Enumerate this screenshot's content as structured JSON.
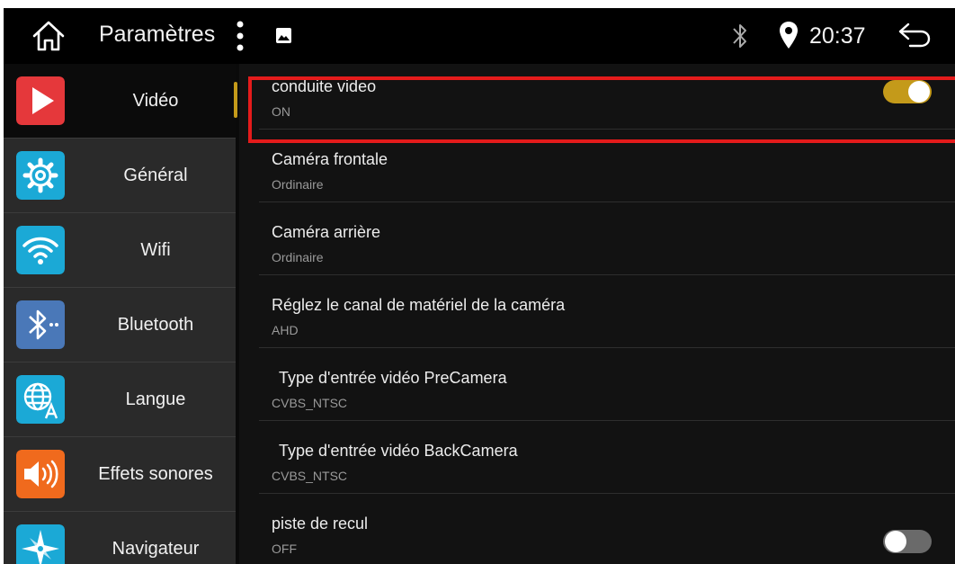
{
  "statusbar": {
    "title": "Paramètres",
    "time": "20:37",
    "icons": [
      "home-icon",
      "more-vert-icon",
      "image-icon",
      "bluetooth-icon",
      "location-icon",
      "back-icon"
    ]
  },
  "sidebar": {
    "items": [
      {
        "label": "Vidéo",
        "icon": "play-icon",
        "color": "#e5383b",
        "active": true
      },
      {
        "label": "Général",
        "icon": "gear-icon",
        "color": "#1ba9d6"
      },
      {
        "label": "Wifi",
        "icon": "wifi-icon",
        "color": "#1ba9d6"
      },
      {
        "label": "Bluetooth",
        "icon": "bluetooth-icon",
        "color": "#4a78b8"
      },
      {
        "label": "Langue",
        "icon": "globe-icon",
        "color": "#1ba9d6"
      },
      {
        "label": "Effets sonores",
        "icon": "speaker-icon",
        "color": "#f06a1d"
      },
      {
        "label": "Navigateur",
        "icon": "compass-icon",
        "color": "#1ba9d6"
      }
    ]
  },
  "settings": [
    {
      "title": "conduite video",
      "subtitle": "ON",
      "toggle": "on"
    },
    {
      "title": "Caméra frontale",
      "subtitle": "Ordinaire"
    },
    {
      "title": "Caméra arrière",
      "subtitle": "Ordinaire"
    },
    {
      "title": "Réglez le canal de matériel de la caméra",
      "subtitle": "AHD"
    },
    {
      "title": "Type d'entrée vidéo PreCamera",
      "subtitle": "CVBS_NTSC"
    },
    {
      "title": "Type d'entrée vidéo BackCamera",
      "subtitle": "CVBS_NTSC"
    },
    {
      "title": "piste de recul",
      "subtitle": "OFF",
      "toggle": "off"
    }
  ],
  "colors": {
    "accent": "#c49a1a",
    "highlight": "#e41b1b"
  }
}
